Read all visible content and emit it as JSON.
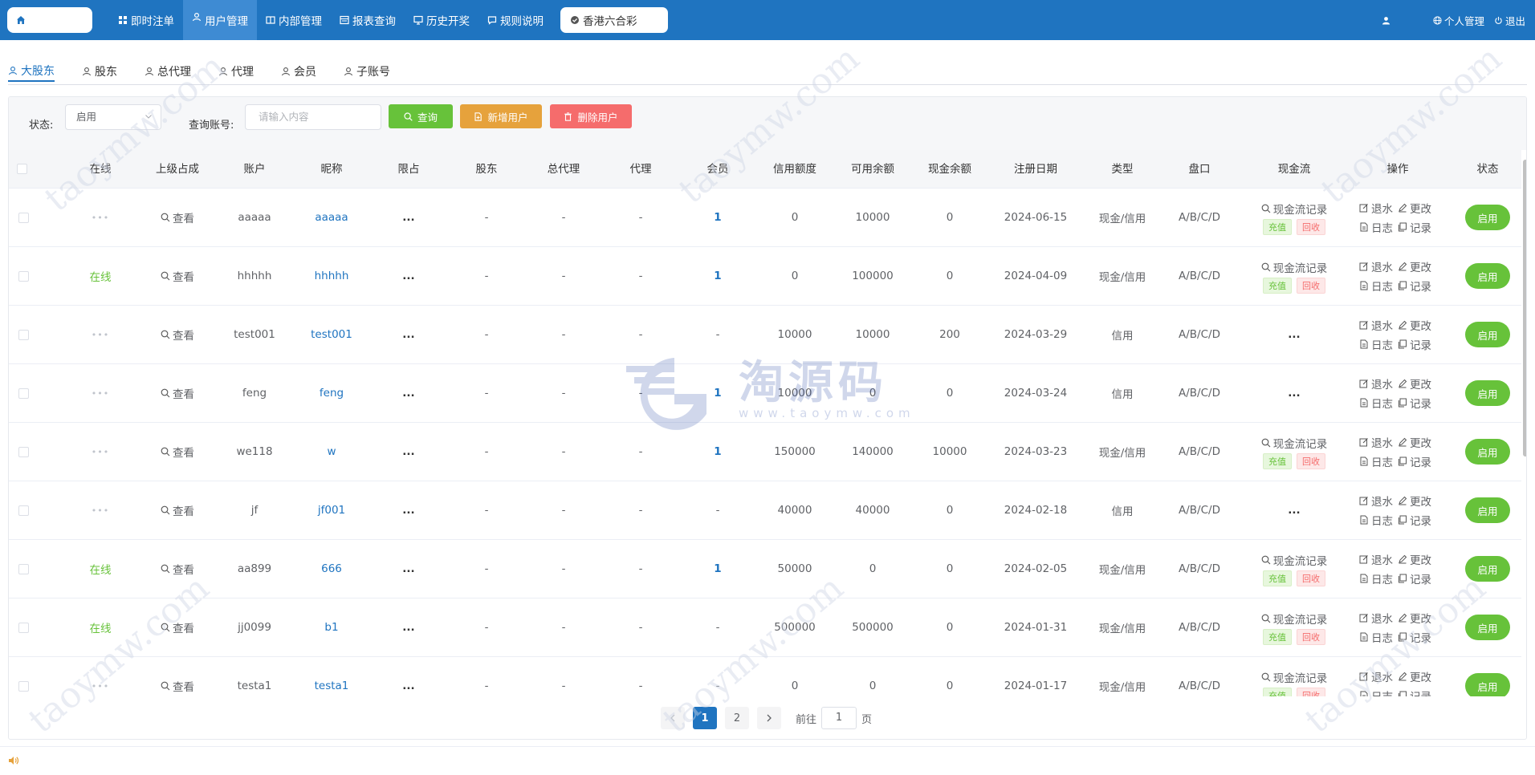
{
  "topbar": {
    "nav": [
      {
        "label": "即时注单",
        "icon": "grid-icon"
      },
      {
        "label": "用户管理",
        "icon": "user-icon",
        "active": true
      },
      {
        "label": "内部管理",
        "icon": "columns-icon"
      },
      {
        "label": "报表查询",
        "icon": "table-icon"
      },
      {
        "label": "历史开奖",
        "icon": "monitor-icon"
      },
      {
        "label": "规则说明",
        "icon": "chat-icon"
      }
    ],
    "lottery": "香港六合彩",
    "right": {
      "profile": "个人管理",
      "logout": "退出"
    }
  },
  "subtabs": [
    "大股东",
    "股东",
    "总代理",
    "代理",
    "会员",
    "子账号"
  ],
  "filter": {
    "status_label": "状态:",
    "status_value": "启用",
    "account_label": "查询账号:",
    "account_placeholder": "请输入内容",
    "search": "查询",
    "add": "新增用户",
    "delete": "删除用户"
  },
  "table": {
    "headers": [
      "在线",
      "上级占成",
      "账户",
      "昵称",
      "限占",
      "股东",
      "总代理",
      "代理",
      "会员",
      "信用额度",
      "可用余额",
      "现金余额",
      "注册日期",
      "类型",
      "盘口",
      "现金流",
      "操作",
      "状态"
    ],
    "view_label": "查看",
    "cash_record": "现金流记录",
    "tag_recharge": "充值",
    "tag_recycle": "回收",
    "op_rebate": "退水",
    "op_change": "更改",
    "op_log": "日志",
    "op_record": "记录",
    "status_btn": "启用",
    "rows": [
      {
        "online": "",
        "account": "aaaaa",
        "nickname": "aaaaa",
        "limit": "...",
        "shareholder": "-",
        "general_agent": "-",
        "agent": "-",
        "member": "1",
        "credit": "0",
        "available": "10000",
        "cash": "0",
        "date": "2024-06-15",
        "type": "现金/信用",
        "plate": "A/B/C/D",
        "cashflow": true
      },
      {
        "online": "在线",
        "account": "hhhhh",
        "nickname": "hhhhh",
        "limit": "...",
        "shareholder": "-",
        "general_agent": "-",
        "agent": "-",
        "member": "1",
        "credit": "0",
        "available": "100000",
        "cash": "0",
        "date": "2024-04-09",
        "type": "现金/信用",
        "plate": "A/B/C/D",
        "cashflow": true
      },
      {
        "online": "",
        "account": "test001",
        "nickname": "test001",
        "limit": "...",
        "shareholder": "-",
        "general_agent": "-",
        "agent": "-",
        "member": "-",
        "credit": "10000",
        "available": "10000",
        "cash": "200",
        "date": "2024-03-29",
        "type": "信用",
        "plate": "A/B/C/D",
        "cashflow": false
      },
      {
        "online": "",
        "account": "feng",
        "nickname": "feng",
        "limit": "...",
        "shareholder": "-",
        "general_agent": "-",
        "agent": "-",
        "member": "1",
        "credit": "10000",
        "available": "0",
        "cash": "0",
        "date": "2024-03-24",
        "type": "信用",
        "plate": "A/B/C/D",
        "cashflow": false
      },
      {
        "online": "",
        "account": "we118",
        "nickname": "w",
        "limit": "...",
        "shareholder": "-",
        "general_agent": "-",
        "agent": "-",
        "member": "1",
        "credit": "150000",
        "available": "140000",
        "cash": "10000",
        "date": "2024-03-23",
        "type": "现金/信用",
        "plate": "A/B/C/D",
        "cashflow": true
      },
      {
        "online": "",
        "account": "jf",
        "nickname": "jf001",
        "limit": "...",
        "shareholder": "-",
        "general_agent": "-",
        "agent": "-",
        "member": "-",
        "credit": "40000",
        "available": "40000",
        "cash": "0",
        "date": "2024-02-18",
        "type": "信用",
        "plate": "A/B/C/D",
        "cashflow": false
      },
      {
        "online": "在线",
        "account": "aa899",
        "nickname": "666",
        "limit": "...",
        "shareholder": "-",
        "general_agent": "-",
        "agent": "-",
        "member": "1",
        "credit": "50000",
        "available": "0",
        "cash": "0",
        "date": "2024-02-05",
        "type": "现金/信用",
        "plate": "A/B/C/D",
        "cashflow": true
      },
      {
        "online": "在线",
        "account": "jj0099",
        "nickname": "b1",
        "limit": "...",
        "shareholder": "-",
        "general_agent": "-",
        "agent": "-",
        "member": "-",
        "credit": "500000",
        "available": "500000",
        "cash": "0",
        "date": "2024-01-31",
        "type": "现金/信用",
        "plate": "A/B/C/D",
        "cashflow": true
      },
      {
        "online": "",
        "account": "testa1",
        "nickname": "testa1",
        "limit": "...",
        "shareholder": "-",
        "general_agent": "-",
        "agent": "-",
        "member": "-",
        "credit": "0",
        "available": "0",
        "cash": "0",
        "date": "2024-01-17",
        "type": "现金/信用",
        "plate": "A/B/C/D",
        "cashflow": true
      }
    ]
  },
  "pagination": {
    "pages": [
      "1",
      "2"
    ],
    "current": "1",
    "goto_label": "前往",
    "goto_value": "1",
    "page_suffix": "页"
  },
  "watermark": {
    "brand": "淘源码",
    "url": "www.taoymw.com",
    "diag": "taoymw.com"
  },
  "colors": {
    "primary": "#1f74c0",
    "success": "#67c23a",
    "warning": "#e6a23c",
    "danger": "#f56c6c"
  }
}
